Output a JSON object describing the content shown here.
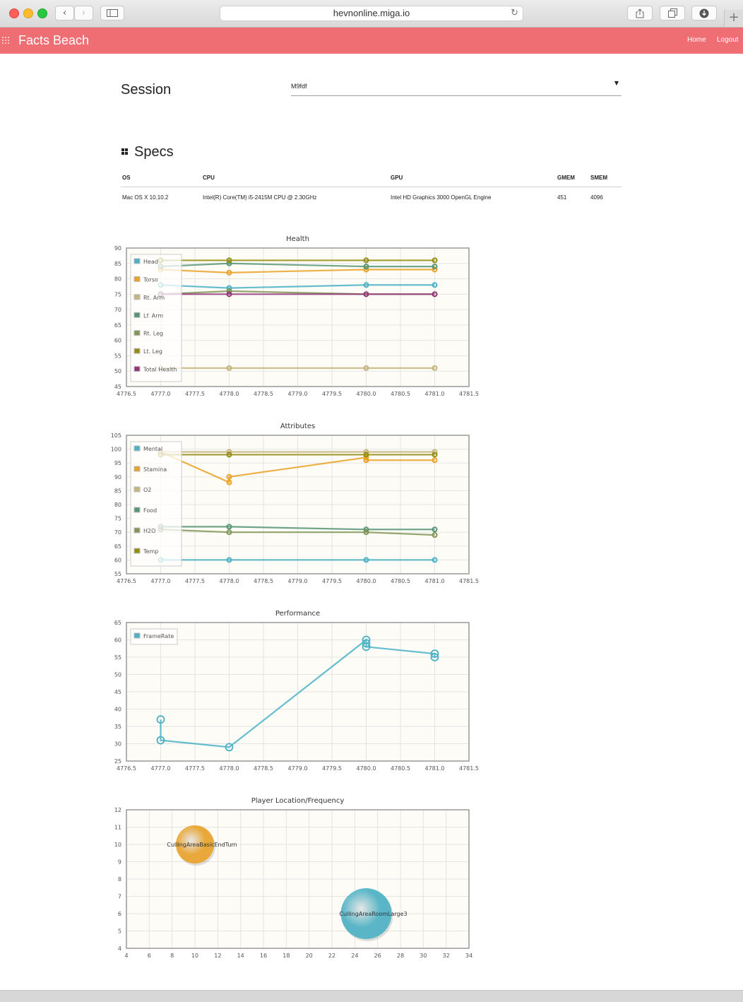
{
  "browser": {
    "url": "hevnonline.miga.io"
  },
  "navbar": {
    "brand": "Facts Beach",
    "links": [
      "Home",
      "Logout"
    ]
  },
  "session": {
    "label": "Session",
    "selected": "M9fdf"
  },
  "specs": {
    "title": "Specs",
    "columns": [
      "OS",
      "CPU",
      "GPU",
      "GMEM",
      "SMEM"
    ],
    "rows": [
      [
        "Mac OS X 10.10.2",
        "Intel(R) Core(TM) i5-2415M CPU @ 2.30GHz",
        "Intel HD Graphics 3000 OpenGL Engine",
        "451",
        "4096"
      ]
    ]
  },
  "colors": {
    "navbar": "#ee6e73",
    "plot_background": "#fdfcf7",
    "series_palette": [
      "#4bb2c5",
      "#eaa228",
      "#c5b47f",
      "#579575",
      "#839557",
      "#958c12",
      "#953579"
    ]
  },
  "chart_data": [
    {
      "type": "line",
      "title": "Health",
      "xlim": [
        4776.5,
        4781.5
      ],
      "ylim": [
        45,
        90
      ],
      "xticks": [
        "4776.5",
        "4777.0",
        "4777.5",
        "4778.0",
        "4778.5",
        "4779.0",
        "4779.5",
        "4780.0",
        "4780.5",
        "4781.0",
        "4781.5"
      ],
      "yticks": [
        "45",
        "50",
        "55",
        "60",
        "65",
        "70",
        "75",
        "80",
        "85",
        "90"
      ],
      "grid": true,
      "legend": "left",
      "series": [
        {
          "name": "Head",
          "color": "#4bb2c5",
          "x": [
            4777,
            4778,
            4780,
            4781
          ],
          "values": [
            78,
            77,
            78,
            78
          ]
        },
        {
          "name": "Torso",
          "color": "#eaa228",
          "x": [
            4777,
            4778,
            4780,
            4781
          ],
          "values": [
            83,
            82,
            83,
            83
          ]
        },
        {
          "name": "Rt. Arm",
          "color": "#c5b47f",
          "x": [
            4777,
            4778,
            4780,
            4781
          ],
          "values": [
            51,
            51,
            51,
            51
          ]
        },
        {
          "name": "Lf. Arm",
          "color": "#579575",
          "x": [
            4777,
            4778,
            4780,
            4781
          ],
          "values": [
            84,
            85,
            84,
            84
          ]
        },
        {
          "name": "Rt. Leg",
          "color": "#839557",
          "x": [
            4777,
            4778,
            4780,
            4781
          ],
          "values": [
            75,
            76,
            75,
            75
          ]
        },
        {
          "name": "Lt. Leg",
          "color": "#958c12",
          "x": [
            4777,
            4778,
            4780,
            4781
          ],
          "values": [
            86,
            86,
            86,
            86
          ]
        },
        {
          "name": "Total Health",
          "color": "#953579",
          "x": [
            4777,
            4778,
            4780,
            4781
          ],
          "values": [
            75,
            75,
            75,
            75
          ]
        }
      ]
    },
    {
      "type": "line",
      "title": "Attributes",
      "xlim": [
        4776.5,
        4781.5
      ],
      "ylim": [
        55,
        105
      ],
      "xticks": [
        "4776.5",
        "4777.0",
        "4777.5",
        "4778.0",
        "4778.5",
        "4779.0",
        "4779.5",
        "4780.0",
        "4780.5",
        "4781.0",
        "4781.5"
      ],
      "yticks": [
        "55",
        "60",
        "65",
        "70",
        "75",
        "80",
        "85",
        "90",
        "95",
        "100",
        "105"
      ],
      "grid": true,
      "legend": "left",
      "series": [
        {
          "name": "Mental",
          "color": "#4bb2c5",
          "x": [
            4777,
            4778,
            4780,
            4781
          ],
          "values": [
            60,
            60,
            60,
            60
          ]
        },
        {
          "name": "Stamina",
          "color": "#eaa228",
          "x": [
            4777,
            4778,
            4778,
            4780,
            4780,
            4781
          ],
          "values": [
            99,
            88,
            90,
            97,
            96,
            96
          ]
        },
        {
          "name": "O2",
          "color": "#c5b47f",
          "x": [
            4777,
            4778,
            4780,
            4781
          ],
          "values": [
            99,
            99,
            99,
            99
          ]
        },
        {
          "name": "Food",
          "color": "#579575",
          "x": [
            4777,
            4778,
            4780,
            4781
          ],
          "values": [
            72,
            72,
            71,
            71
          ]
        },
        {
          "name": "H2O",
          "color": "#839557",
          "x": [
            4777,
            4778,
            4780,
            4781
          ],
          "values": [
            71,
            70,
            70,
            69
          ]
        },
        {
          "name": "Temp",
          "color": "#958c12",
          "x": [
            4777,
            4778,
            4780,
            4781
          ],
          "values": [
            98,
            98,
            98,
            98
          ]
        }
      ]
    },
    {
      "type": "line",
      "title": "Performance",
      "xlim": [
        4776.5,
        4781.5
      ],
      "ylim": [
        25,
        65
      ],
      "xticks": [
        "4776.5",
        "4777.0",
        "4777.5",
        "4778.0",
        "4778.5",
        "4779.0",
        "4779.5",
        "4780.0",
        "4780.5",
        "4781.0",
        "4781.5"
      ],
      "yticks": [
        "25",
        "30",
        "35",
        "40",
        "45",
        "50",
        "55",
        "60",
        "65"
      ],
      "grid": true,
      "legend": "left",
      "series": [
        {
          "name": "FrameRate",
          "color": "#4bb2c5",
          "x": [
            4777,
            4777,
            4778,
            4780,
            4780,
            4780,
            4781,
            4781
          ],
          "values": [
            37,
            31,
            29,
            60,
            59,
            58,
            56,
            55
          ]
        }
      ]
    },
    {
      "type": "scatter",
      "title": "Player Location/Frequency",
      "xlim": [
        4,
        34
      ],
      "ylim": [
        4,
        12
      ],
      "xticks": [
        "4",
        "6",
        "8",
        "10",
        "12",
        "14",
        "16",
        "18",
        "20",
        "22",
        "24",
        "26",
        "28",
        "30",
        "32",
        "34"
      ],
      "yticks": [
        "4",
        "5",
        "6",
        "7",
        "8",
        "9",
        "10",
        "11",
        "12"
      ],
      "grid": true,
      "points": [
        {
          "label": "CullingAreaBasicEndTurn",
          "x": 10,
          "y": 10,
          "size": 3,
          "color": "#eaa228"
        },
        {
          "label": "CullingAreaRoomLarge3",
          "x": 25,
          "y": 6,
          "size": 4,
          "color": "#4bb2c5"
        }
      ]
    }
  ]
}
